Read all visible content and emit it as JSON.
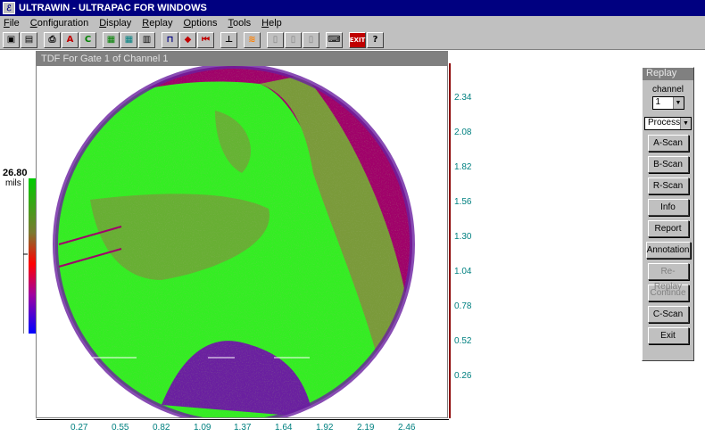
{
  "window": {
    "title": "ULTRAWIN - ULTRAPAC FOR WINDOWS"
  },
  "menu": [
    "File",
    "Configuration",
    "Display",
    "Replay",
    "Options",
    "Tools",
    "Help"
  ],
  "toolbar": {
    "buttons": [
      "open-icon",
      "save-icon",
      "print-icon",
      "a-scan-icon",
      "c-scan-icon",
      "green-grid-icon",
      "blue-grid-icon",
      "channels-icon",
      "gate-icon",
      "play-icon",
      "rewind-icon",
      "axis-icon",
      "rainbow-icon",
      "page1-icon",
      "page2-icon",
      "page3-icon",
      "keyboard-icon"
    ],
    "exit_label": "EXIT",
    "help_label": "?"
  },
  "plot": {
    "title": "TDF For Gate 1 of Channel 1",
    "y_ticks": [
      "2.34",
      "2.08",
      "1.82",
      "1.56",
      "1.30",
      "1.04",
      "0.78",
      "0.52",
      "0.26"
    ],
    "x_ticks": [
      "0.27",
      "0.55",
      "0.82",
      "1.09",
      "1.37",
      "1.64",
      "1.92",
      "2.19",
      "2.46"
    ]
  },
  "colorbar": {
    "value": "26.80",
    "unit": "mils",
    "colors": {
      "top": "#00cc00",
      "mid": "#ff0000",
      "bottom": "#0000ff"
    }
  },
  "colors": {
    "green": "#33ee22",
    "magenta": "#a0006a",
    "purple": "#6a1fa0",
    "olive": "#7a9a3a",
    "axis": "#008080"
  },
  "replay": {
    "title": "Replay",
    "channel_label": "channel",
    "channel_value": "1",
    "mode_value": "Process",
    "buttons": [
      {
        "label": "A-Scan",
        "enabled": true
      },
      {
        "label": "B-Scan",
        "enabled": true
      },
      {
        "label": "R-Scan",
        "enabled": true
      },
      {
        "label": "Info",
        "enabled": true
      },
      {
        "label": "Report",
        "enabled": true
      },
      {
        "label": "Annotation",
        "enabled": true
      },
      {
        "label": "Re-Replay",
        "enabled": false
      },
      {
        "label": "Continue",
        "enabled": false
      },
      {
        "label": "C-Scan",
        "enabled": true
      },
      {
        "label": "Exit",
        "enabled": true
      }
    ]
  }
}
